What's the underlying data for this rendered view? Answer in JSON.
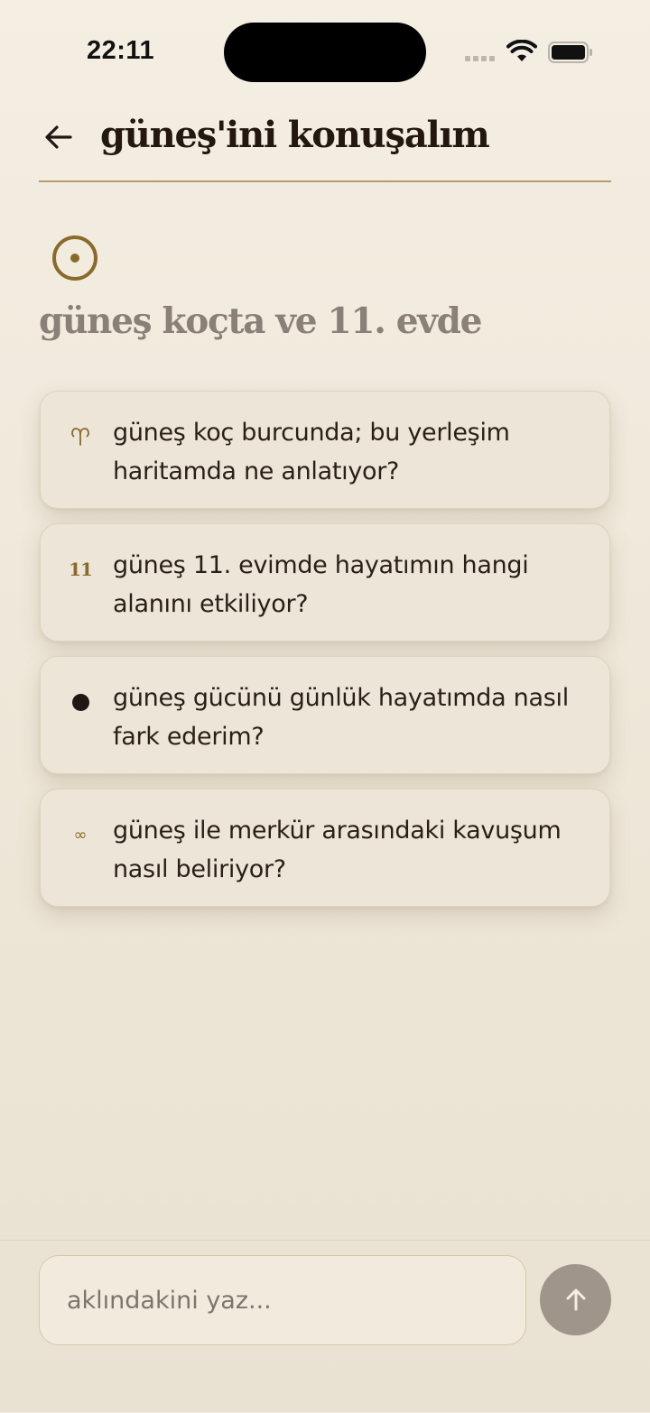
{
  "status_bar": {
    "time": "22:11"
  },
  "header": {
    "title": "güneş'ini konuşalım",
    "back_icon": "arrow-left-icon"
  },
  "section": {
    "symbol_icon": "sun-symbol-icon",
    "heading": "güneş koçta ve 11. evde"
  },
  "suggestions": [
    {
      "icon": "aries-icon",
      "icon_text": "♈",
      "text": "güneş koç burcunda; bu yerleşim haritamda ne anlatıyor?"
    },
    {
      "icon": "house-number-icon",
      "icon_text": "11",
      "text": "güneş 11. evimde hayatımın hangi alanını etkiliyor?"
    },
    {
      "icon": "dot-icon",
      "icon_text": "",
      "text": "güneş gücünü günlük hayatımda nasıl fark ederim?"
    },
    {
      "icon": "conjunction-icon",
      "icon_text": "∞",
      "text": "güneş ile merkür arasındaki kavuşum nasıl beliriyor?"
    }
  ],
  "composer": {
    "placeholder": "aklındakini yaz...",
    "value": "",
    "send_icon": "arrow-up-icon"
  },
  "colors": {
    "accent": "#8a6a2c",
    "divider": "#b59c6d",
    "send_button": "#a0958a",
    "heading_muted": "#8a8078"
  }
}
